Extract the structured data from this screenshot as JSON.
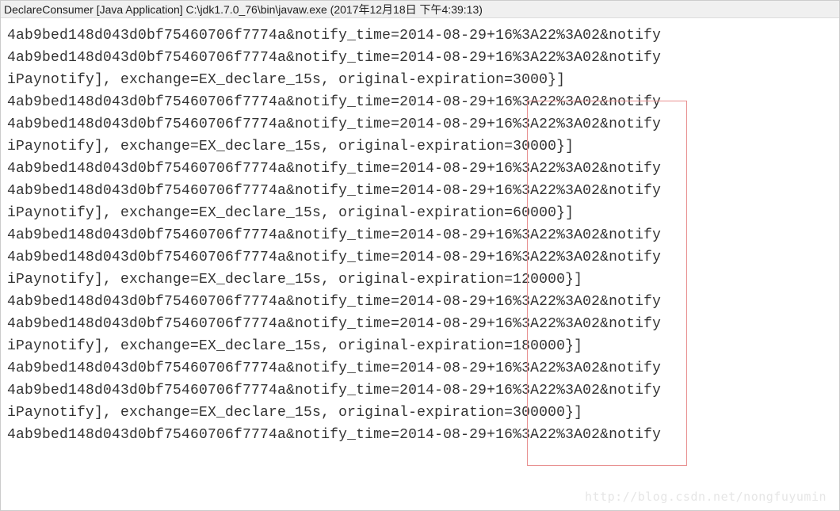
{
  "header": {
    "title": "DeclareConsumer [Java Application] C:\\jdk1.7.0_76\\bin\\javaw.exe (2017年12月18日 下午4:39:13)"
  },
  "console": {
    "lines": [
      "4ab9bed148d043d0bf75460706f7774a&notify_time=2014-08-29+16%3A22%3A02&notify",
      "4ab9bed148d043d0bf75460706f7774a&notify_time=2014-08-29+16%3A22%3A02&notify",
      "iPaynotify], exchange=EX_declare_15s, original-expiration=3000}]",
      "4ab9bed148d043d0bf75460706f7774a&notify_time=2014-08-29+16%3A22%3A02&notify",
      "4ab9bed148d043d0bf75460706f7774a&notify_time=2014-08-29+16%3A22%3A02&notify",
      "iPaynotify], exchange=EX_declare_15s, original-expiration=30000}]",
      "4ab9bed148d043d0bf75460706f7774a&notify_time=2014-08-29+16%3A22%3A02&notify",
      "4ab9bed148d043d0bf75460706f7774a&notify_time=2014-08-29+16%3A22%3A02&notify",
      "iPaynotify], exchange=EX_declare_15s, original-expiration=60000}]",
      "4ab9bed148d043d0bf75460706f7774a&notify_time=2014-08-29+16%3A22%3A02&notify",
      "4ab9bed148d043d0bf75460706f7774a&notify_time=2014-08-29+16%3A22%3A02&notify",
      "iPaynotify], exchange=EX_declare_15s, original-expiration=120000}]",
      "4ab9bed148d043d0bf75460706f7774a&notify_time=2014-08-29+16%3A22%3A02&notify",
      "4ab9bed148d043d0bf75460706f7774a&notify_time=2014-08-29+16%3A22%3A02&notify",
      "iPaynotify], exchange=EX_declare_15s, original-expiration=180000}]",
      "4ab9bed148d043d0bf75460706f7774a&notify_time=2014-08-29+16%3A22%3A02&notify",
      "4ab9bed148d043d0bf75460706f7774a&notify_time=2014-08-29+16%3A22%3A02&notify",
      "iPaynotify], exchange=EX_declare_15s, original-expiration=300000}]",
      "4ab9bed148d043d0bf75460706f7774a&notify_time=2014-08-29+16%3A22%3A02&notify"
    ]
  },
  "watermark": {
    "text": "http://blog.csdn.net/nongfuyumin"
  }
}
